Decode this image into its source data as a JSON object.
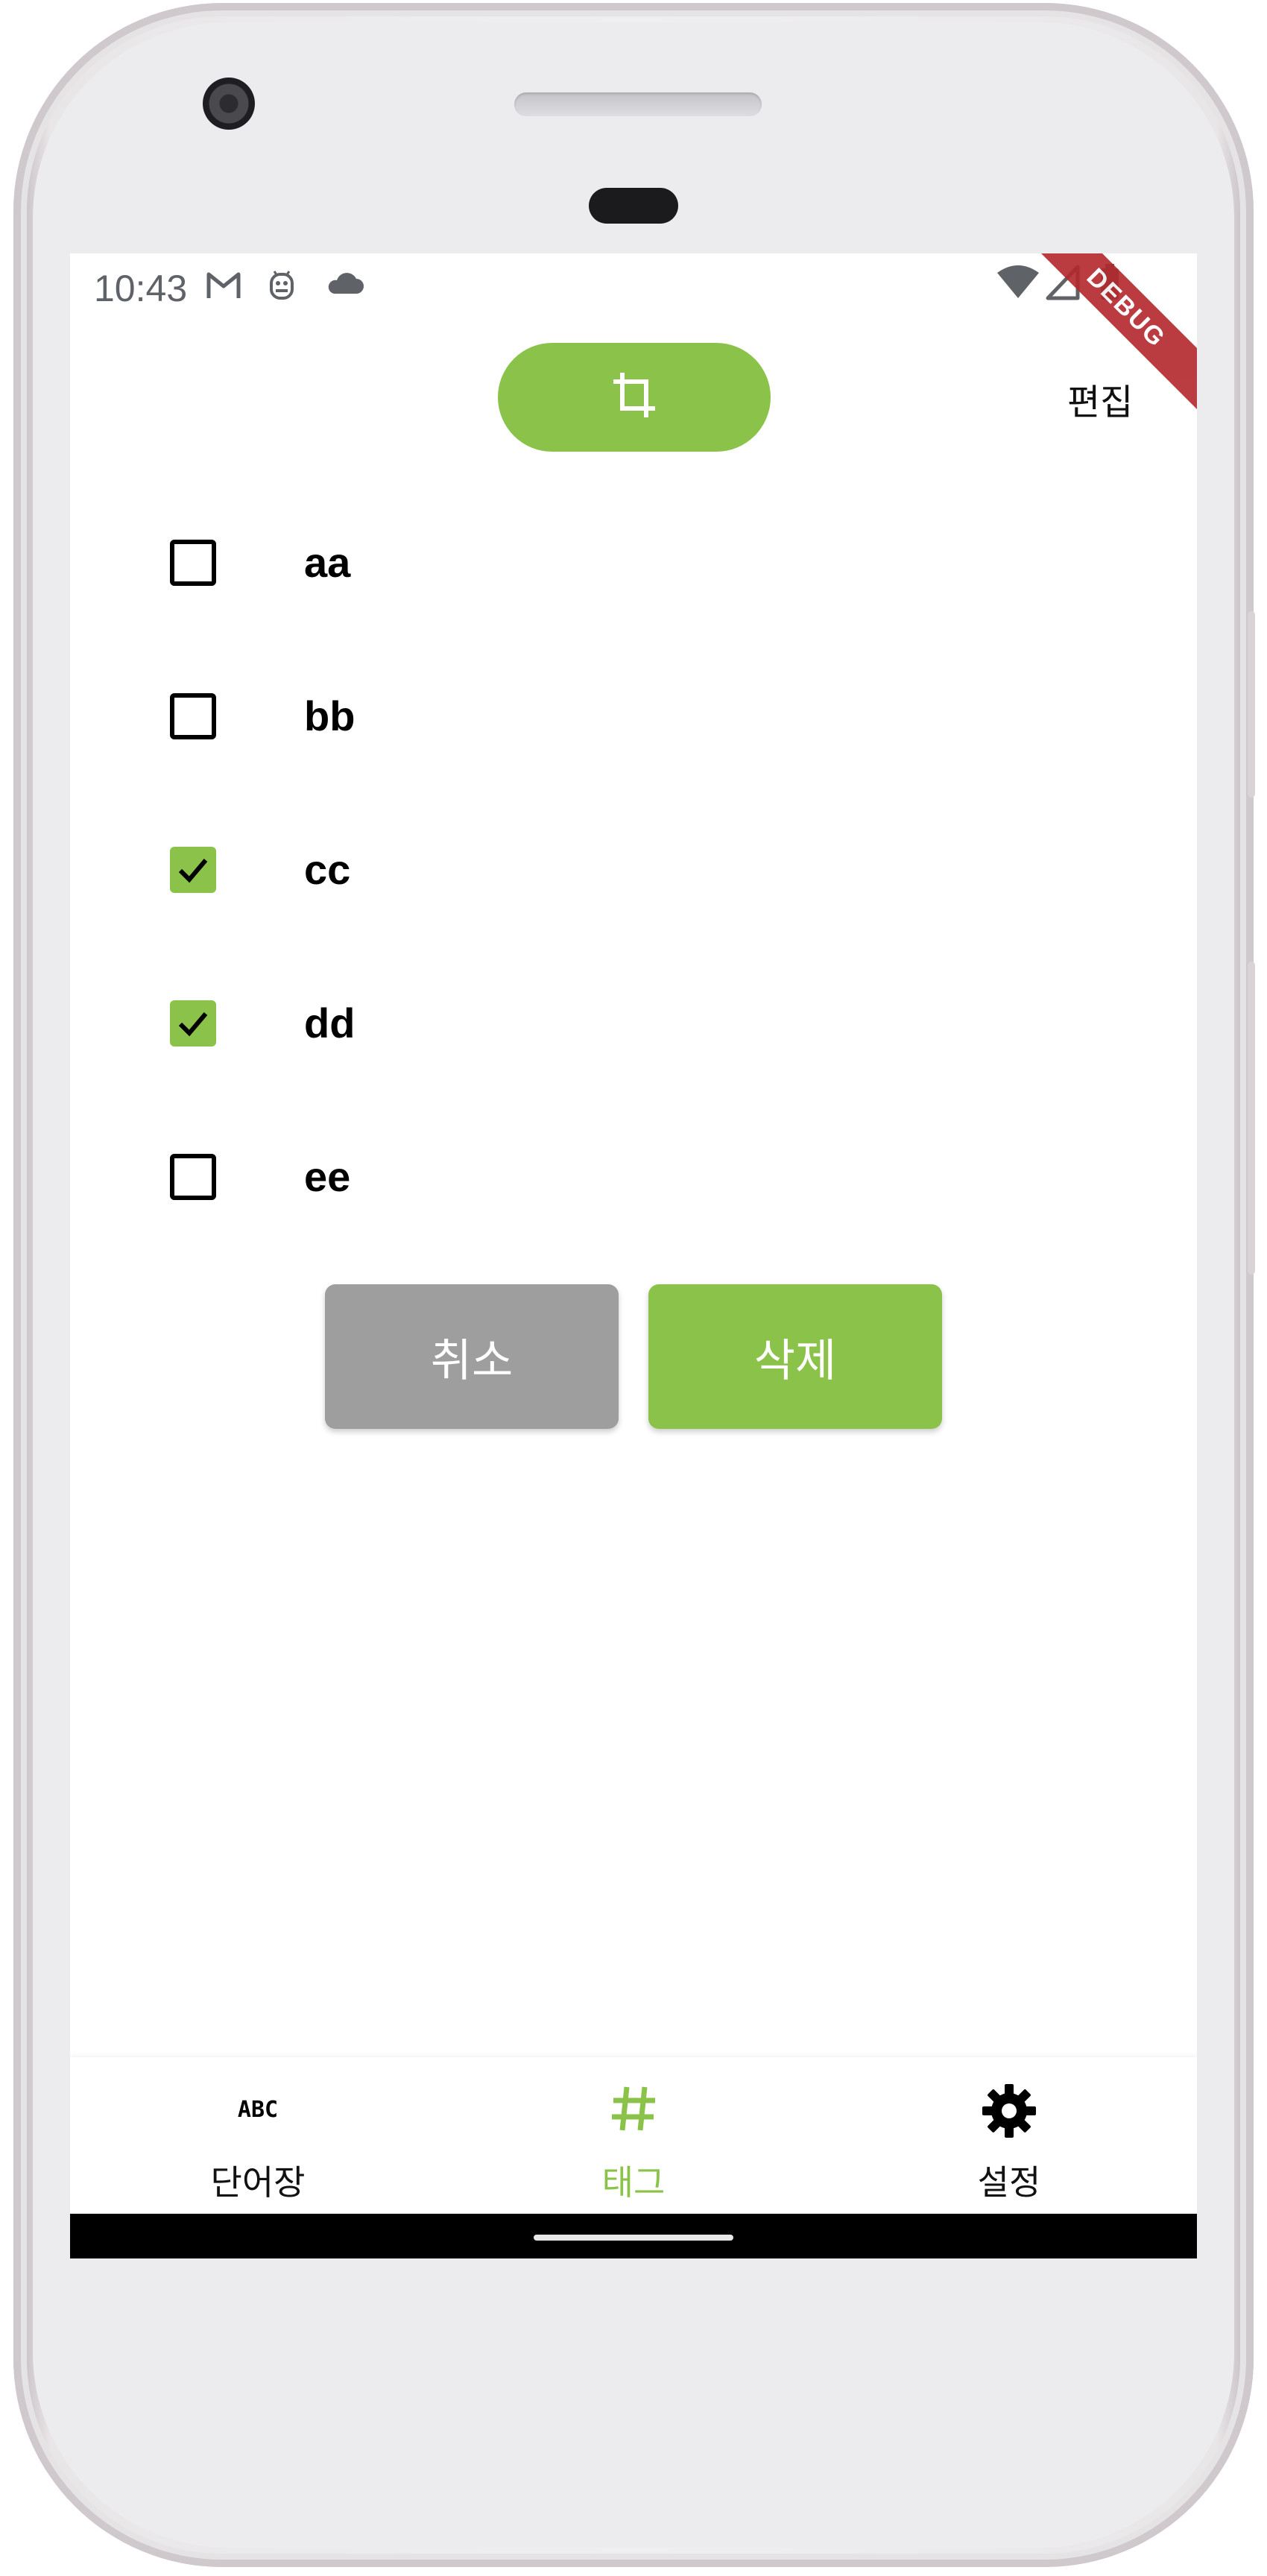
{
  "status_bar": {
    "time": "10:43",
    "left_icons": [
      "gmail-icon",
      "android-robot-icon",
      "cloud-icon"
    ],
    "right_icons": [
      "wifi-icon",
      "cell-signal-icon",
      "battery-icon"
    ]
  },
  "debug_banner": {
    "label": "DEBUG"
  },
  "header": {
    "crop_button_icon": "crop-icon",
    "edit_label": "편집"
  },
  "tags": [
    {
      "label": "aa",
      "checked": false
    },
    {
      "label": "bb",
      "checked": false
    },
    {
      "label": "cc",
      "checked": true
    },
    {
      "label": "dd",
      "checked": true
    },
    {
      "label": "ee",
      "checked": false
    }
  ],
  "actions": {
    "cancel_label": "취소",
    "delete_label": "삭제"
  },
  "bottom_nav": {
    "items": [
      {
        "label": "단어장",
        "icon": "abc-icon",
        "active": false
      },
      {
        "label": "태그",
        "icon": "hashtag-icon",
        "active": true
      },
      {
        "label": "설정",
        "icon": "gear-icon",
        "active": false
      }
    ]
  },
  "colors": {
    "accent": "#8bc34a",
    "cancel": "#9e9e9e",
    "debug_ribbon": "#b3282d",
    "text": "#000000"
  }
}
